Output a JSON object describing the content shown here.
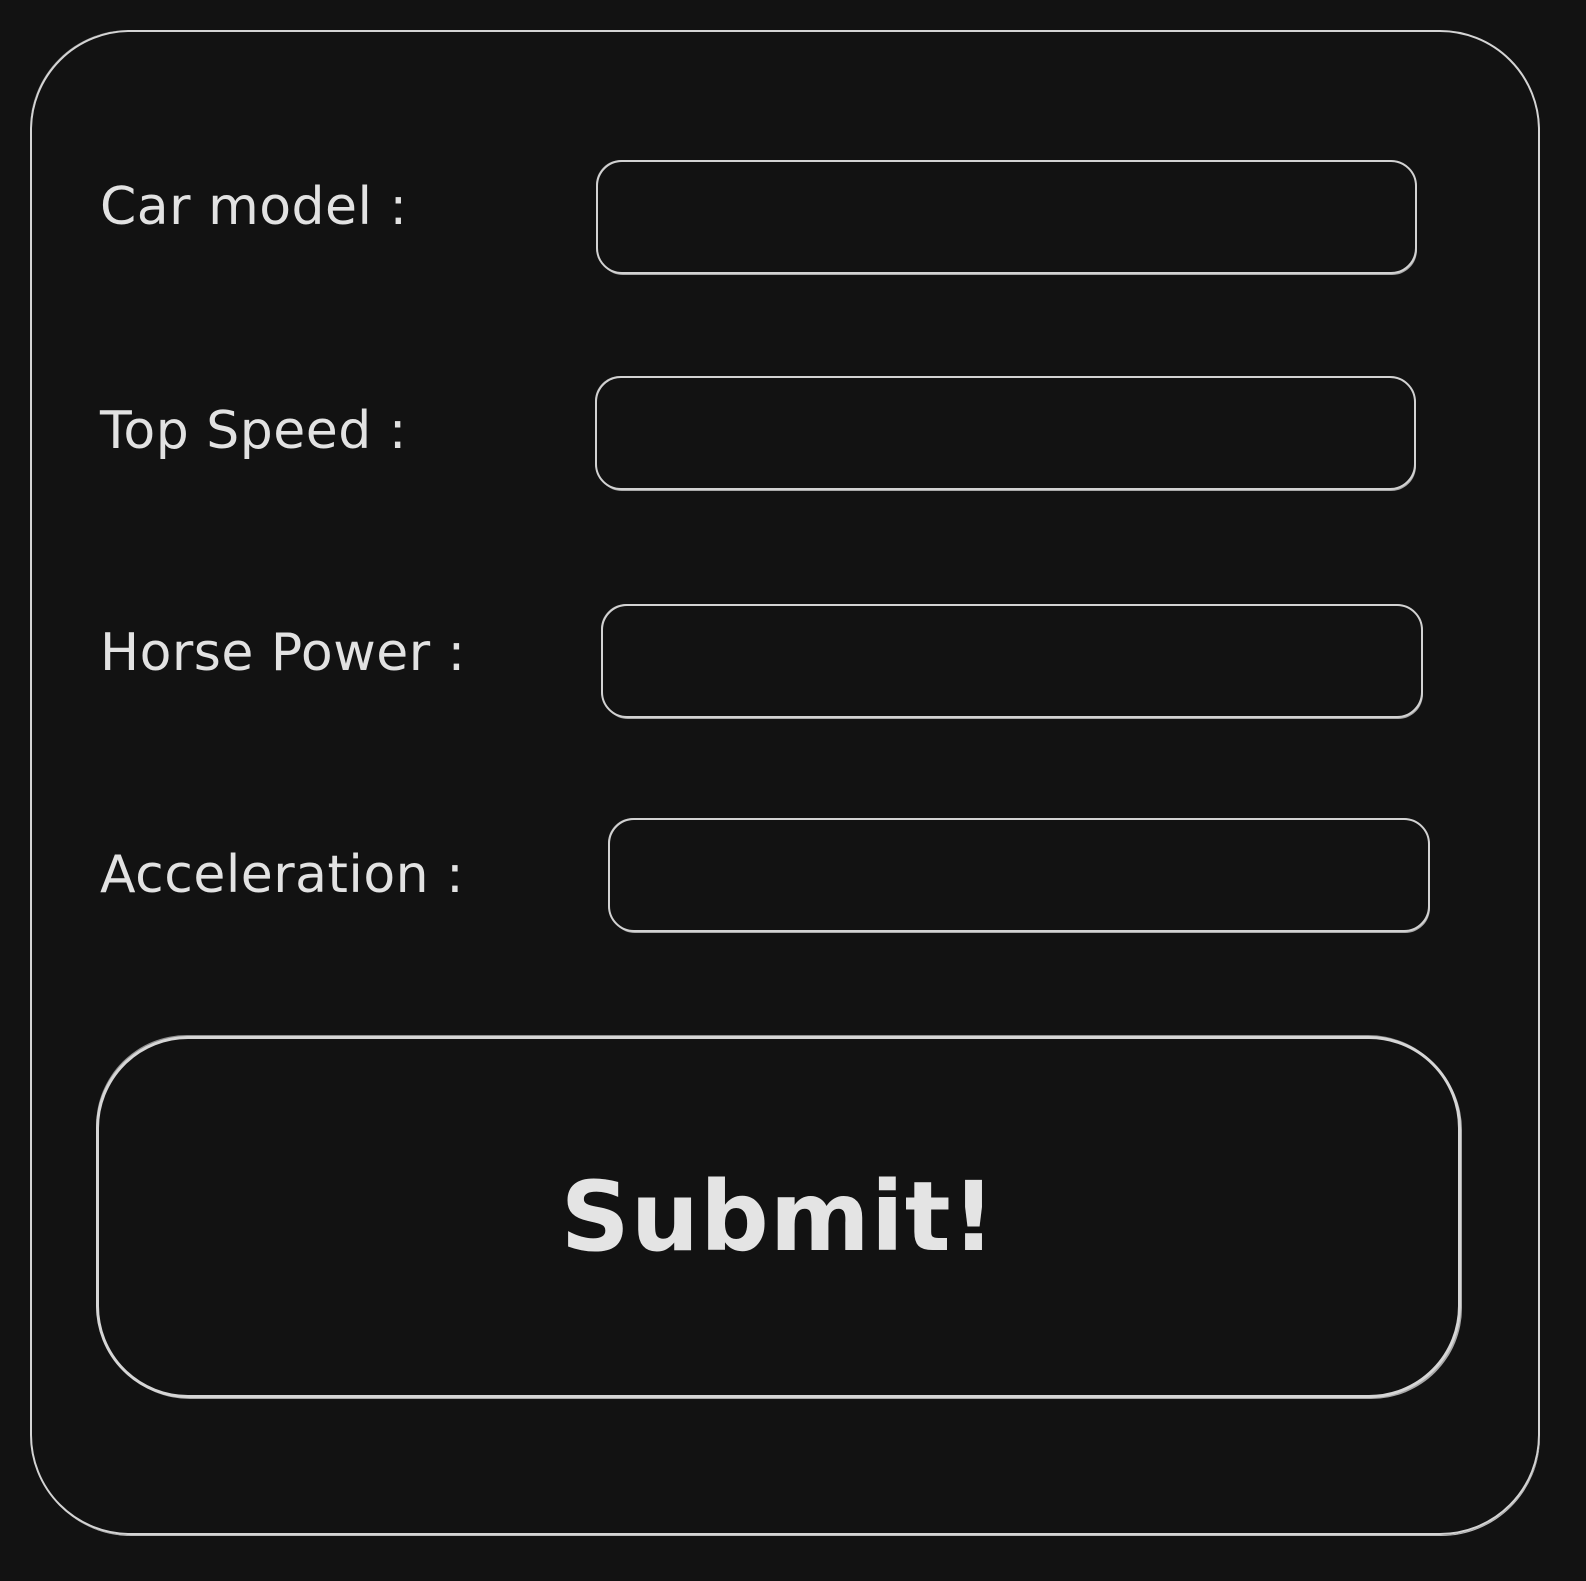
{
  "form": {
    "fields": [
      {
        "label": "Car model :",
        "value": ""
      },
      {
        "label": "Top Speed :",
        "value": ""
      },
      {
        "label": "Horse Power :",
        "value": ""
      },
      {
        "label": "Acceleration :",
        "value": ""
      }
    ],
    "submit_label": "Submit!"
  },
  "colors": {
    "background": "#121212",
    "stroke": "#d4d4d4",
    "text": "#e2e2e2"
  }
}
